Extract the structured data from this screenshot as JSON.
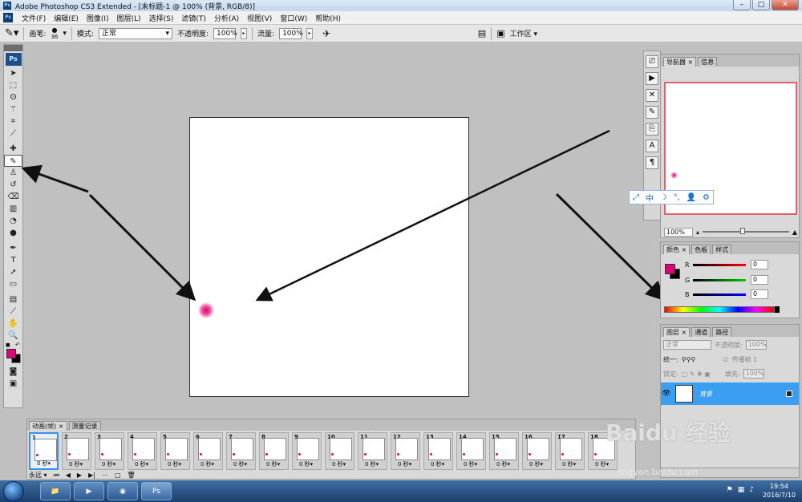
{
  "titlebar": {
    "title": "Adobe Photoshop CS3 Extended - [未标题-1 @ 100% (背景, RGB/8)]",
    "app_icon": "Ps",
    "buttons": [
      "–",
      "□",
      "✕"
    ]
  },
  "menubar": {
    "icon": "Ps",
    "items": [
      "文件(F)",
      "编辑(E)",
      "图像(I)",
      "图层(L)",
      "选择(S)",
      "滤镜(T)",
      "分析(A)",
      "视图(V)",
      "窗口(W)",
      "帮助(H)"
    ]
  },
  "options": {
    "brush_label": "画笔:",
    "brush_size": "36",
    "mode_label": "模式:",
    "mode_value": "正常",
    "opacity_label": "不透明度:",
    "opacity_value": "100%",
    "flow_label": "流量:",
    "flow_value": "100%",
    "workspace_label": "工作区 ▾"
  },
  "toolbox": {
    "logo": "Ps"
  },
  "panels": {
    "navigator": {
      "tabs": [
        "导航器 ×",
        "信息"
      ],
      "zoom": "100%"
    },
    "ime": [
      "⤢",
      "中",
      "☽",
      "°,",
      "👤",
      "⚙"
    ],
    "color": {
      "tabs": [
        "颜色 ×",
        "色板",
        "样式"
      ],
      "channels": [
        {
          "label": "R",
          "value": "0",
          "color": "#cc0000"
        },
        {
          "label": "G",
          "value": "0",
          "color": "#00aa00"
        },
        {
          "label": "B",
          "value": "0",
          "color": "#0000cc"
        }
      ],
      "foreground": "#e0007a",
      "background": "#000000"
    },
    "layers": {
      "tabs": [
        "图层 ×",
        "通道",
        "路径"
      ],
      "blend_mode": "正常",
      "opacity_label": "不透明度:",
      "opacity_value": "100%",
      "unify_label": "统一:",
      "propagate_label": "传播帧 1",
      "lock_label": "锁定:",
      "fill_label": "填充:",
      "fill_value": "100%",
      "layer_name": "背景"
    }
  },
  "animation": {
    "tabs": [
      "动画(帧) ×",
      "测量记录"
    ],
    "frames": [
      {
        "num": "1",
        "delay": "0 秒▾"
      },
      {
        "num": "2",
        "delay": "0 秒▾"
      },
      {
        "num": "3",
        "delay": "0 秒▾"
      },
      {
        "num": "4",
        "delay": "0 秒▾"
      },
      {
        "num": "5",
        "delay": "0 秒▾"
      },
      {
        "num": "6",
        "delay": "0 秒▾"
      },
      {
        "num": "7",
        "delay": "0 秒▾"
      },
      {
        "num": "8",
        "delay": "0 秒▾"
      },
      {
        "num": "9",
        "delay": "0 秒▾"
      },
      {
        "num": "10",
        "delay": "0 秒▾"
      },
      {
        "num": "11",
        "delay": "0 秒▾"
      },
      {
        "num": "12",
        "delay": "0 秒▾"
      },
      {
        "num": "13",
        "delay": "0 秒▾"
      },
      {
        "num": "14",
        "delay": "0 秒▾"
      },
      {
        "num": "15",
        "delay": "0 秒▾"
      },
      {
        "num": "16",
        "delay": "0 秒▾"
      },
      {
        "num": "17",
        "delay": "0 秒▾"
      },
      {
        "num": "18",
        "delay": "0 秒▾"
      }
    ],
    "loop_label": "永远 ▾"
  },
  "taskbar": {
    "ps_label": "Ps",
    "time": "19:54",
    "date": "2016/7/10"
  },
  "watermark": {
    "brand": "Baidu 经验",
    "url": "jingyan.baidu.com"
  }
}
